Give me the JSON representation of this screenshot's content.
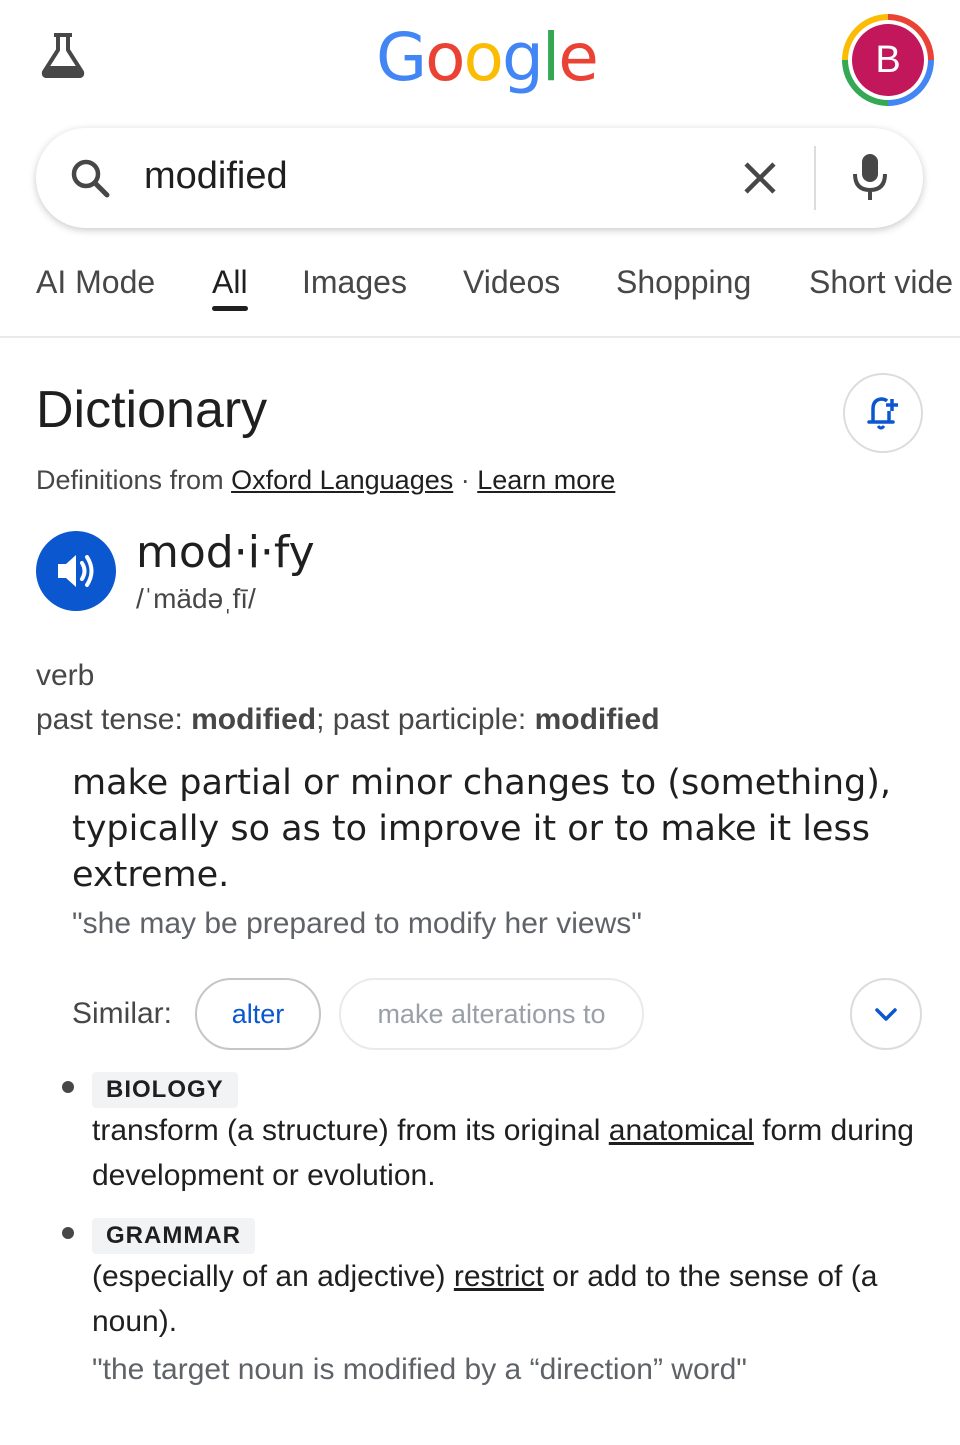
{
  "header": {
    "labs_icon": "flask-icon",
    "logo_letters": [
      {
        "ch": "G",
        "color": "#4285f4"
      },
      {
        "ch": "o",
        "color": "#ea4335"
      },
      {
        "ch": "o",
        "color": "#fbbc05"
      },
      {
        "ch": "g",
        "color": "#4285f4"
      },
      {
        "ch": "l",
        "color": "#34a853"
      },
      {
        "ch": "e",
        "color": "#ea4335"
      }
    ],
    "avatar_letter": "B",
    "avatar_color": "#c2185b"
  },
  "search": {
    "query": "modified",
    "icons": [
      "search-icon",
      "close-icon",
      "mic-icon"
    ]
  },
  "tabs": [
    {
      "label": "AI Mode",
      "active": false
    },
    {
      "label": "All",
      "active": true
    },
    {
      "label": "Images",
      "active": false
    },
    {
      "label": "Videos",
      "active": false
    },
    {
      "label": "Shopping",
      "active": false
    },
    {
      "label": "Short vide",
      "active": false
    }
  ],
  "dictionary": {
    "title": "Dictionary",
    "source_prefix": "Definitions from ",
    "source_link": "Oxford Languages",
    "separator": " · ",
    "learn_more": "Learn more",
    "headword": "mod·i·fy",
    "pronunciation": "/ˈmädəˌfī/",
    "part_of_speech": "verb",
    "forms": {
      "past_tense_label": "past tense",
      "past_tense": "modified",
      "past_participle_label": "past participle",
      "past_participle": "modified"
    },
    "definition_1": "make partial or minor changes to (something), typically so as to improve it or to make it less extreme.",
    "example_1": "\"she may be prepared to modify her views\"",
    "similar_label": "Similar:",
    "similar": [
      "alter",
      "make alterations to"
    ],
    "senses": [
      {
        "tag": "BIOLOGY",
        "before": "transform (a structure) from its original ",
        "link": "anatomical",
        "after": " form during development or evolution."
      },
      {
        "tag": "GRAMMAR",
        "before": "(especially of an adjective) ",
        "link": "restrict",
        "after": " or add to the sense of (a noun).",
        "example": "\"the target noun is modified by a “direction” word\""
      }
    ]
  },
  "colors": {
    "accent_blue": "#0b57d0",
    "text_primary": "#1f1f1f",
    "text_secondary": "#474747"
  }
}
